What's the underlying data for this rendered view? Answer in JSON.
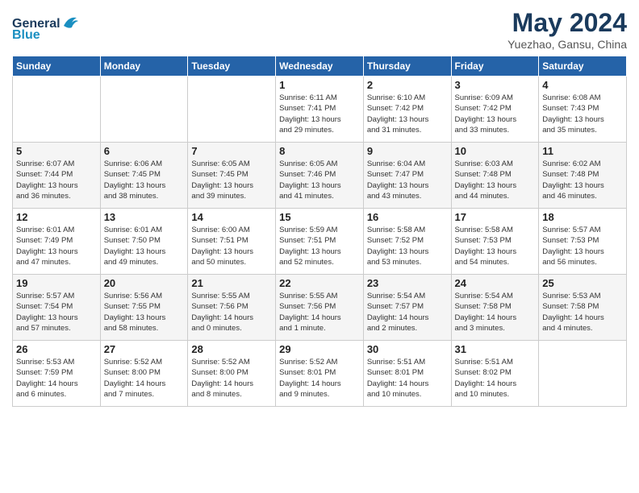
{
  "header": {
    "logo_line1": "General",
    "logo_line2": "Blue",
    "month": "May 2024",
    "location": "Yuezhao, Gansu, China"
  },
  "days_of_week": [
    "Sunday",
    "Monday",
    "Tuesday",
    "Wednesday",
    "Thursday",
    "Friday",
    "Saturday"
  ],
  "weeks": [
    [
      {
        "day": "",
        "info": ""
      },
      {
        "day": "",
        "info": ""
      },
      {
        "day": "",
        "info": ""
      },
      {
        "day": "1",
        "info": "Sunrise: 6:11 AM\nSunset: 7:41 PM\nDaylight: 13 hours\nand 29 minutes."
      },
      {
        "day": "2",
        "info": "Sunrise: 6:10 AM\nSunset: 7:42 PM\nDaylight: 13 hours\nand 31 minutes."
      },
      {
        "day": "3",
        "info": "Sunrise: 6:09 AM\nSunset: 7:42 PM\nDaylight: 13 hours\nand 33 minutes."
      },
      {
        "day": "4",
        "info": "Sunrise: 6:08 AM\nSunset: 7:43 PM\nDaylight: 13 hours\nand 35 minutes."
      }
    ],
    [
      {
        "day": "5",
        "info": "Sunrise: 6:07 AM\nSunset: 7:44 PM\nDaylight: 13 hours\nand 36 minutes."
      },
      {
        "day": "6",
        "info": "Sunrise: 6:06 AM\nSunset: 7:45 PM\nDaylight: 13 hours\nand 38 minutes."
      },
      {
        "day": "7",
        "info": "Sunrise: 6:05 AM\nSunset: 7:45 PM\nDaylight: 13 hours\nand 39 minutes."
      },
      {
        "day": "8",
        "info": "Sunrise: 6:05 AM\nSunset: 7:46 PM\nDaylight: 13 hours\nand 41 minutes."
      },
      {
        "day": "9",
        "info": "Sunrise: 6:04 AM\nSunset: 7:47 PM\nDaylight: 13 hours\nand 43 minutes."
      },
      {
        "day": "10",
        "info": "Sunrise: 6:03 AM\nSunset: 7:48 PM\nDaylight: 13 hours\nand 44 minutes."
      },
      {
        "day": "11",
        "info": "Sunrise: 6:02 AM\nSunset: 7:48 PM\nDaylight: 13 hours\nand 46 minutes."
      }
    ],
    [
      {
        "day": "12",
        "info": "Sunrise: 6:01 AM\nSunset: 7:49 PM\nDaylight: 13 hours\nand 47 minutes."
      },
      {
        "day": "13",
        "info": "Sunrise: 6:01 AM\nSunset: 7:50 PM\nDaylight: 13 hours\nand 49 minutes."
      },
      {
        "day": "14",
        "info": "Sunrise: 6:00 AM\nSunset: 7:51 PM\nDaylight: 13 hours\nand 50 minutes."
      },
      {
        "day": "15",
        "info": "Sunrise: 5:59 AM\nSunset: 7:51 PM\nDaylight: 13 hours\nand 52 minutes."
      },
      {
        "day": "16",
        "info": "Sunrise: 5:58 AM\nSunset: 7:52 PM\nDaylight: 13 hours\nand 53 minutes."
      },
      {
        "day": "17",
        "info": "Sunrise: 5:58 AM\nSunset: 7:53 PM\nDaylight: 13 hours\nand 54 minutes."
      },
      {
        "day": "18",
        "info": "Sunrise: 5:57 AM\nSunset: 7:53 PM\nDaylight: 13 hours\nand 56 minutes."
      }
    ],
    [
      {
        "day": "19",
        "info": "Sunrise: 5:57 AM\nSunset: 7:54 PM\nDaylight: 13 hours\nand 57 minutes."
      },
      {
        "day": "20",
        "info": "Sunrise: 5:56 AM\nSunset: 7:55 PM\nDaylight: 13 hours\nand 58 minutes."
      },
      {
        "day": "21",
        "info": "Sunrise: 5:55 AM\nSunset: 7:56 PM\nDaylight: 14 hours\nand 0 minutes."
      },
      {
        "day": "22",
        "info": "Sunrise: 5:55 AM\nSunset: 7:56 PM\nDaylight: 14 hours\nand 1 minute."
      },
      {
        "day": "23",
        "info": "Sunrise: 5:54 AM\nSunset: 7:57 PM\nDaylight: 14 hours\nand 2 minutes."
      },
      {
        "day": "24",
        "info": "Sunrise: 5:54 AM\nSunset: 7:58 PM\nDaylight: 14 hours\nand 3 minutes."
      },
      {
        "day": "25",
        "info": "Sunrise: 5:53 AM\nSunset: 7:58 PM\nDaylight: 14 hours\nand 4 minutes."
      }
    ],
    [
      {
        "day": "26",
        "info": "Sunrise: 5:53 AM\nSunset: 7:59 PM\nDaylight: 14 hours\nand 6 minutes."
      },
      {
        "day": "27",
        "info": "Sunrise: 5:52 AM\nSunset: 8:00 PM\nDaylight: 14 hours\nand 7 minutes."
      },
      {
        "day": "28",
        "info": "Sunrise: 5:52 AM\nSunset: 8:00 PM\nDaylight: 14 hours\nand 8 minutes."
      },
      {
        "day": "29",
        "info": "Sunrise: 5:52 AM\nSunset: 8:01 PM\nDaylight: 14 hours\nand 9 minutes."
      },
      {
        "day": "30",
        "info": "Sunrise: 5:51 AM\nSunset: 8:01 PM\nDaylight: 14 hours\nand 10 minutes."
      },
      {
        "day": "31",
        "info": "Sunrise: 5:51 AM\nSunset: 8:02 PM\nDaylight: 14 hours\nand 10 minutes."
      },
      {
        "day": "",
        "info": ""
      }
    ]
  ]
}
